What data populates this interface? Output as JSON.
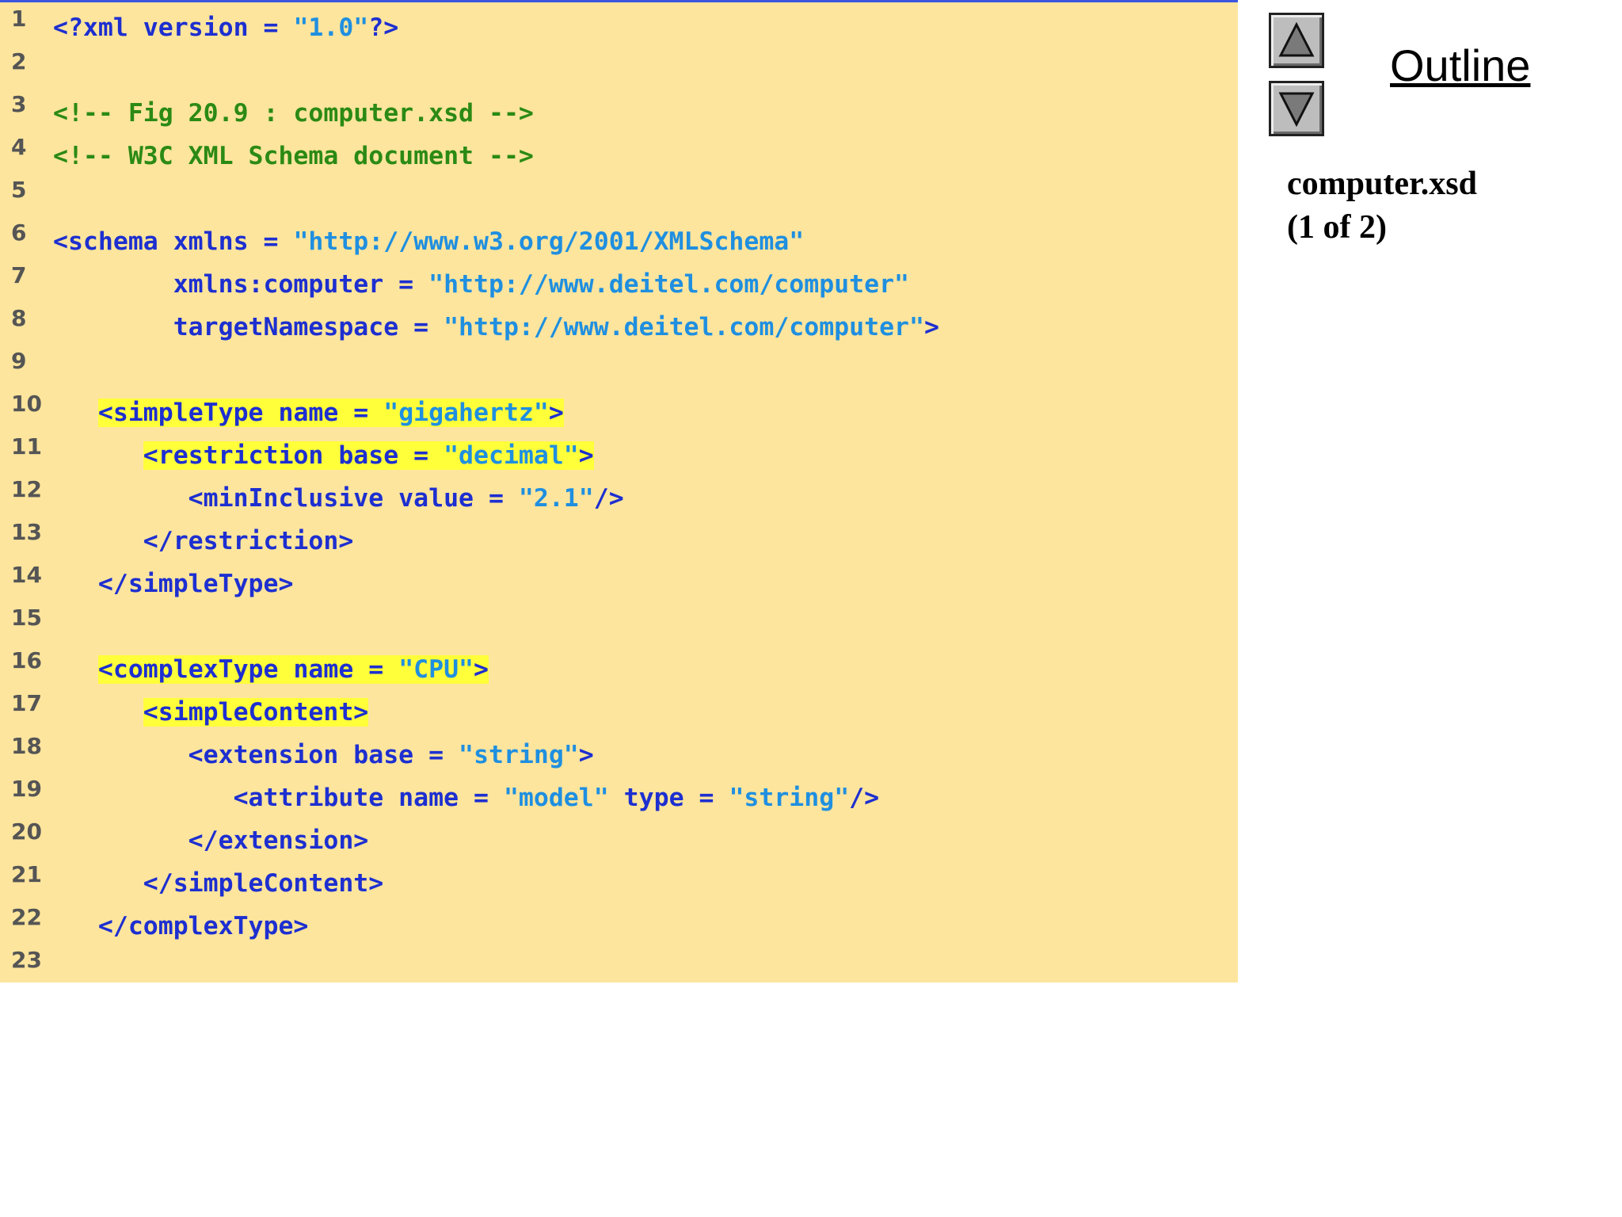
{
  "outline": {
    "title": "Outline",
    "file_name": "computer.xsd",
    "page_label": "(1 of 2)",
    "up_icon": "triangle-up-icon",
    "down_icon": "triangle-down-icon"
  },
  "colors": {
    "panel_bg": "#fde59d",
    "tag": "#1d2fd0",
    "value": "#1f8fe0",
    "comment": "#2b8a14",
    "highlight": "#ffff3a"
  },
  "code_lines": [
    {
      "num": "1",
      "segments": [
        {
          "t": "<?xml version = ",
          "k": "tag"
        },
        {
          "t": "\"1.0\"",
          "k": "val"
        },
        {
          "t": "?>",
          "k": "tag"
        }
      ]
    },
    {
      "num": "2",
      "segments": []
    },
    {
      "num": "3",
      "segments": [
        {
          "t": "<!-- Fig 20.9 : computer.xsd -->",
          "k": "cmt"
        }
      ]
    },
    {
      "num": "4",
      "segments": [
        {
          "t": "<!-- W3C XML Schema document -->",
          "k": "cmt"
        }
      ]
    },
    {
      "num": "5",
      "segments": []
    },
    {
      "num": "6",
      "segments": [
        {
          "t": "<schema xmlns = ",
          "k": "tag"
        },
        {
          "t": "\"http://www.w3.org/2001/XMLSchema\"",
          "k": "val"
        }
      ]
    },
    {
      "num": "7",
      "segments": [
        {
          "t": "        xmlns:computer = ",
          "k": "tag"
        },
        {
          "t": "\"http://www.deitel.com/computer\"",
          "k": "val"
        }
      ]
    },
    {
      "num": "8",
      "segments": [
        {
          "t": "        targetNamespace = ",
          "k": "tag"
        },
        {
          "t": "\"http://www.deitel.com/computer\"",
          "k": "val"
        },
        {
          "t": ">",
          "k": "tag"
        }
      ]
    },
    {
      "num": "9",
      "segments": []
    },
    {
      "num": "10",
      "segments": [
        {
          "t": "   ",
          "k": "plain"
        },
        {
          "t": "<simpleType name = ",
          "k": "tag",
          "hl": true
        },
        {
          "t": "\"gigahertz\"",
          "k": "val",
          "hl": true
        },
        {
          "t": ">",
          "k": "tag",
          "hl": true
        }
      ]
    },
    {
      "num": "11",
      "segments": [
        {
          "t": "      ",
          "k": "plain"
        },
        {
          "t": "<restriction base = ",
          "k": "tag",
          "hl": true
        },
        {
          "t": "\"decimal\"",
          "k": "val",
          "hl": true
        },
        {
          "t": ">",
          "k": "tag",
          "hl": true
        }
      ]
    },
    {
      "num": "12",
      "segments": [
        {
          "t": "         <minInclusive value = ",
          "k": "tag"
        },
        {
          "t": "\"2.1\"",
          "k": "val"
        },
        {
          "t": "/>",
          "k": "tag"
        }
      ]
    },
    {
      "num": "13",
      "segments": [
        {
          "t": "      </restriction>",
          "k": "tag"
        }
      ]
    },
    {
      "num": "14",
      "segments": [
        {
          "t": "   </simpleType>",
          "k": "tag"
        }
      ]
    },
    {
      "num": "15",
      "segments": []
    },
    {
      "num": "16",
      "segments": [
        {
          "t": "   ",
          "k": "plain"
        },
        {
          "t": "<complexType name = ",
          "k": "tag",
          "hl": true
        },
        {
          "t": "\"CPU\"",
          "k": "val",
          "hl": true
        },
        {
          "t": ">",
          "k": "tag",
          "hl": true
        }
      ]
    },
    {
      "num": "17",
      "segments": [
        {
          "t": "      ",
          "k": "plain"
        },
        {
          "t": "<simpleContent>",
          "k": "tag",
          "hl": true
        }
      ]
    },
    {
      "num": "18",
      "segments": [
        {
          "t": "         <extension base = ",
          "k": "tag"
        },
        {
          "t": "\"string\"",
          "k": "val"
        },
        {
          "t": ">",
          "k": "tag"
        }
      ]
    },
    {
      "num": "19",
      "segments": [
        {
          "t": "            <attribute name = ",
          "k": "tag"
        },
        {
          "t": "\"model\"",
          "k": "val"
        },
        {
          "t": " type = ",
          "k": "tag"
        },
        {
          "t": "\"string\"",
          "k": "val"
        },
        {
          "t": "/>",
          "k": "tag"
        }
      ]
    },
    {
      "num": "20",
      "segments": [
        {
          "t": "         </extension>",
          "k": "tag"
        }
      ]
    },
    {
      "num": "21",
      "segments": [
        {
          "t": "      </simpleContent>",
          "k": "tag"
        }
      ]
    },
    {
      "num": "22",
      "segments": [
        {
          "t": "   </complexType>",
          "k": "tag"
        }
      ]
    },
    {
      "num": "23",
      "segments": []
    }
  ]
}
